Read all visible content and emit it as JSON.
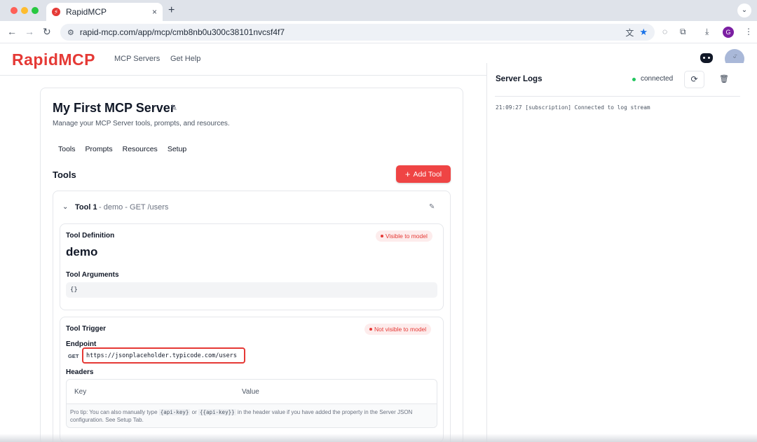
{
  "browser": {
    "tab_title": "RapidMCP",
    "tab_close": "×",
    "new_tab": "+",
    "menu": "⌄",
    "url": "rapid-mcp.com/app/mcp/cmb8nb0u300c38101nvcsf4f7",
    "profile_initial": "G"
  },
  "header": {
    "logo": "RapidMCP",
    "nav": [
      "MCP Servers",
      "Get Help"
    ]
  },
  "server": {
    "title": "My First MCP Server",
    "subtitle": "Manage your MCP Server tools, prompts, and resources.",
    "tabs": [
      "Tools",
      "Prompts",
      "Resources",
      "Setup"
    ],
    "section_title": "Tools",
    "add_tool_label": "Add Tool"
  },
  "tool": {
    "name": "Tool 1",
    "meta": " - demo - GET /users",
    "definition_label": "Tool Definition",
    "visible_badge": "Visible to model",
    "def_name": "demo",
    "args_label": "Tool Arguments",
    "args_value": "{}",
    "trigger_label": "Tool Trigger",
    "not_visible_badge": "Not visible to model",
    "endpoint_label": "Endpoint",
    "method": "GET",
    "endpoint_url": "https://jsonplaceholder.typicode.com/users",
    "headers_label": "Headers",
    "header_columns": [
      "Key",
      "Value"
    ],
    "protip": {
      "part1": "Pro tip: You can also manually type ",
      "code1": "{api-key}",
      "part2": " or ",
      "code2": "{{api-key}}",
      "part3": " in the header value if you have added the property in the Server JSON configuration. See Setup Tab."
    }
  },
  "logs": {
    "title": "Server Logs",
    "status": "connected",
    "line": "21:09:27 [subscription] Connected to log stream"
  },
  "colors": {
    "brand": "#e53935",
    "status_connected": "#22c55e"
  }
}
